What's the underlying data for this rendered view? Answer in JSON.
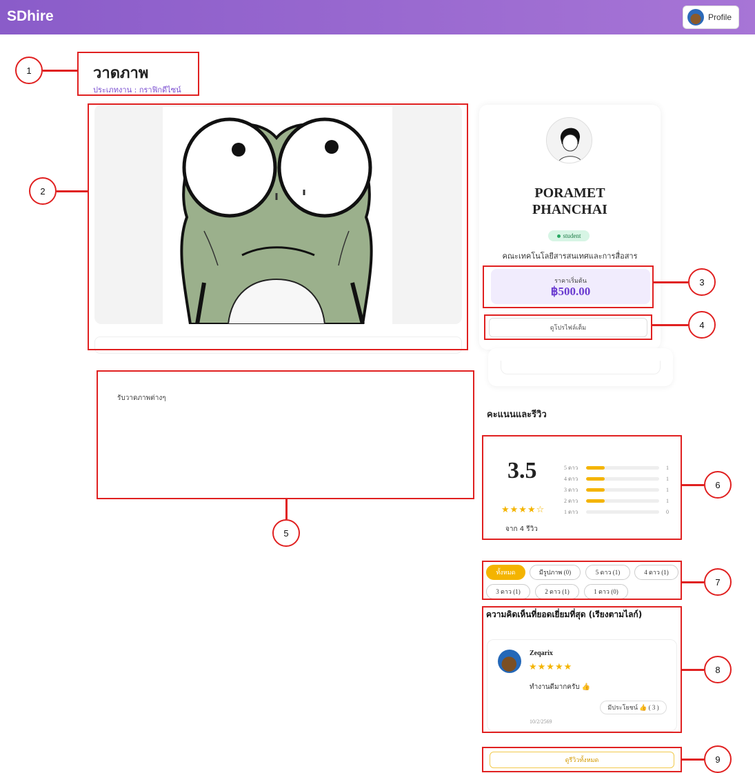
{
  "app": {
    "brand": "SDhire",
    "profile_label": "Profile"
  },
  "job": {
    "title": "วาดภาพ",
    "category": "ประเภทงาน : กราฟิกดีไซน์",
    "description": "รับวาดภาพต่างๆ"
  },
  "seller": {
    "name_line1": "PORAMET",
    "name_line2": "PHANCHAI",
    "badge": "student",
    "faculty": "คณะเทคโนโลยีสารสนเทศและการสื่อสาร",
    "price_label": "ราคาเริ่มต้น",
    "price": "฿500.00",
    "full_profile_label": "ดูโปรไฟล์เต็ม"
  },
  "reviews": {
    "heading": "คะแนนและรีวิว",
    "average": "3.5",
    "stars": "★★★★☆",
    "count_text": "จาก 4 รีวิว",
    "distribution": [
      {
        "label": "5 ดาว",
        "count": "1",
        "fraction": 0.25
      },
      {
        "label": "4 ดาว",
        "count": "1",
        "fraction": 0.25
      },
      {
        "label": "3 ดาว",
        "count": "1",
        "fraction": 0.25
      },
      {
        "label": "2 ดาว",
        "count": "1",
        "fraction": 0.25
      },
      {
        "label": "1 ดาว",
        "count": "0",
        "fraction": 0
      }
    ],
    "filters": [
      "ทั้งหมด",
      "มีรูปภาพ (0)",
      "5 ดาว (1)",
      "4 ดาว (1)",
      "3 ดาว (1)",
      "2 ดาว (1)",
      "1 ดาว (0)"
    ],
    "active_filter": "ทั้งหมด",
    "top_comment_title": "ความคิดเห็นที่ยอดเยี่ยมที่สุด (เรียงตามไลก์)",
    "top_comment": {
      "user": "Zeqarix",
      "stars": "★★★★★",
      "text": "ทำงานดีมากครับ 👍",
      "helpful": "มีประโยชน์ 👍 ( 3 )",
      "date": "10/2/2569"
    },
    "all_reviews_label": "ดูรีวิวทั้งหมด"
  },
  "annotations": [
    "1",
    "2",
    "3",
    "4",
    "5",
    "6",
    "7",
    "8",
    "9"
  ],
  "colors": {
    "header_start": "#8a5cc9",
    "header_end": "#a775d6",
    "accent_purple": "#6a3bd0",
    "star": "#f4b400",
    "annotation_red": "#e02020"
  }
}
